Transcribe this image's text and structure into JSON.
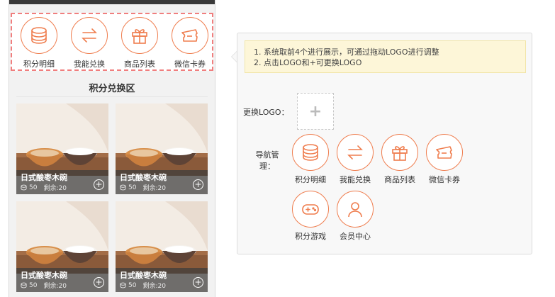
{
  "phone": {
    "nav_items": [
      {
        "label": "积分明细",
        "icon": "coins-icon"
      },
      {
        "label": "我能兑换",
        "icon": "exchange-arrows-icon"
      },
      {
        "label": "商品列表",
        "icon": "gift-box-icon"
      },
      {
        "label": "微信卡券",
        "icon": "ticket-icon"
      }
    ],
    "section_title": "积分兑换区",
    "products": [
      {
        "name": "日式酸枣木碗",
        "points": "50",
        "stock": "剩余:20"
      },
      {
        "name": "日式酸枣木碗",
        "points": "50",
        "stock": "剩余:20"
      },
      {
        "name": "日式酸枣木碗",
        "points": "50",
        "stock": "剩余:20"
      },
      {
        "name": "日式酸枣木碗",
        "points": "50",
        "stock": "剩余:20"
      }
    ]
  },
  "panel": {
    "tips": [
      "1. 系统取前4个进行展示，可通过拖动LOGO进行调整",
      "2. 点击LOGO和+可更换LOGO"
    ],
    "change_logo_label": "更换LOGO：",
    "upload_symbol": "+",
    "nav_manage_label_line1": "导航管",
    "nav_manage_label_line2": "理：",
    "nav_items": [
      {
        "label": "积分明细",
        "icon": "coins-icon"
      },
      {
        "label": "我能兑换",
        "icon": "exchange-arrows-icon"
      },
      {
        "label": "商品列表",
        "icon": "gift-box-icon"
      },
      {
        "label": "微信卡券",
        "icon": "ticket-icon"
      },
      {
        "label": "积分游戏",
        "icon": "gamepad-icon"
      },
      {
        "label": "会员中心",
        "icon": "user-icon"
      }
    ]
  },
  "colors": {
    "accent": "#ef7d4e",
    "dashed_border": "#f07e7e",
    "tip_bg": "#fdf6d8"
  }
}
